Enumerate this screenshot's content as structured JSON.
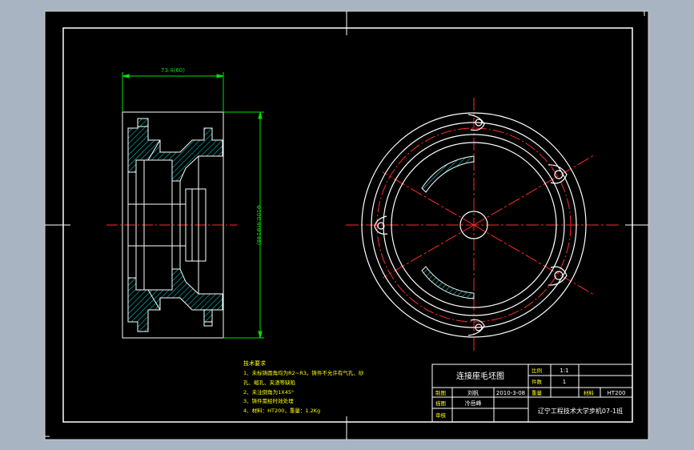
{
  "drawing": {
    "title": "连接座毛坯图",
    "dim_width": "73.4(60)",
    "dim_height": "Φ100.4(Φ148)",
    "tech_requirements": {
      "heading": "技术要求",
      "lines": [
        "1、未标铸圆角均为R2~R3。铸件不允许有气孔、砂",
        "孔、缩孔、夹渣等缺陷",
        "2、未注倒角为1X45°",
        "3、铸件需经时效处理",
        "4、材料：HT200，重量：1.2Kg"
      ]
    },
    "title_block": {
      "scale_label": "比例",
      "scale_value": "1:1",
      "qty_label": "件数",
      "qty_value": "1",
      "weight_label": "重量",
      "material_label": "材料",
      "material_value": "HT200",
      "drawn_label": "制图",
      "drawn_name": "刘帆",
      "drawn_date": "2010-3-08",
      "design_label": "描图",
      "design_name": "冷岳峰",
      "check_label": "审核",
      "school": "辽宁工程技术大学步机07-1班"
    }
  },
  "colors": {
    "background": "#000000",
    "outer_frame": "#ffffff",
    "outline": "#ffffff",
    "center_line": "#ff2a2a",
    "hatch": "#00c4c4",
    "dimension": "#00e000",
    "notes_text": "#ffff00",
    "desktop": "#a9b4c2"
  }
}
